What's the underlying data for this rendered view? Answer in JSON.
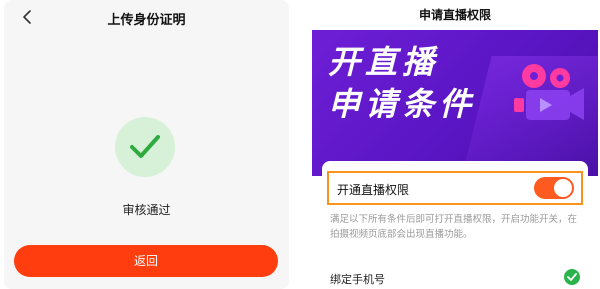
{
  "left": {
    "title": "上传身份证明",
    "status_text": "审核通过",
    "return_label": "返回",
    "colors": {
      "button": "#ff3d0f",
      "success_bg": "#d6f1d8",
      "success_check": "#2eaa40"
    }
  },
  "right": {
    "title": "申请直播权限",
    "banner": {
      "line1": "开直播",
      "line2": "申请条件",
      "colors": {
        "bg_start": "#6e1fd6",
        "bg_end": "#4b11a8",
        "camera_accent": "#ff3aa0"
      }
    },
    "toggle": {
      "label": "开通直播权限",
      "state": "on",
      "colors": {
        "on": "#ff5a1f",
        "highlight_border": "#f7941d"
      }
    },
    "description": "满足以下所有条件后即可打开直播权限，开启功能开关，在拍摄视频页底部会出现直播功能。",
    "conditions": [
      {
        "label": "绑定手机号",
        "status": "satisfied",
        "icon": "check-circle-icon"
      }
    ]
  }
}
